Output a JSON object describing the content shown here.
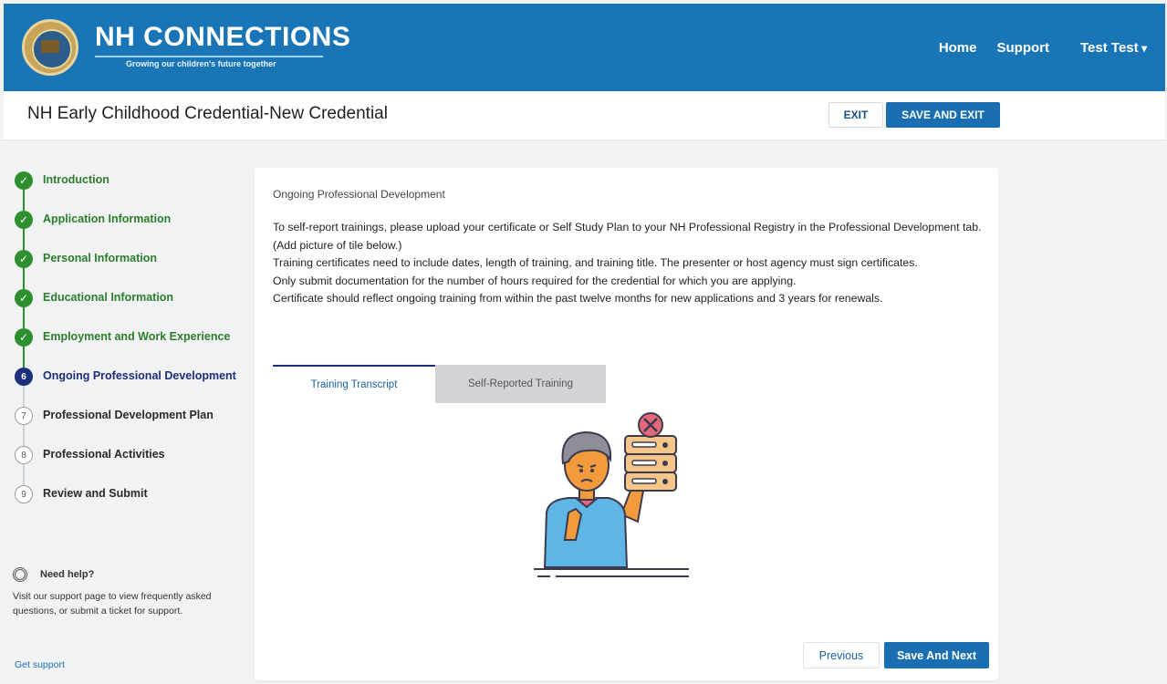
{
  "brand": {
    "title": "NH CONNECTIONS",
    "tagline": "Growing our children's future together"
  },
  "nav": {
    "home": "Home",
    "support": "Support",
    "user": "Test Test"
  },
  "header": {
    "title": "NH Early Childhood Credential-New Credential",
    "exit_label": "EXIT",
    "save_exit_label": "SAVE AND EXIT"
  },
  "steps": [
    {
      "label": "Introduction",
      "status": "done",
      "icon": "check-icon"
    },
    {
      "label": "Application Information",
      "status": "done",
      "icon": "check-icon"
    },
    {
      "label": "Personal Information",
      "status": "done",
      "icon": "check-icon"
    },
    {
      "label": "Educational Information",
      "status": "done",
      "icon": "check-icon"
    },
    {
      "label": "Employment and Work Experience",
      "status": "done",
      "icon": "check-icon"
    },
    {
      "label": "Ongoing Professional Development",
      "status": "current",
      "number": "6"
    },
    {
      "label": "Professional Development Plan",
      "status": "todo",
      "number": "7"
    },
    {
      "label": "Professional Activities",
      "status": "todo",
      "number": "8"
    },
    {
      "label": "Review and Submit",
      "status": "todo",
      "number": "9"
    }
  ],
  "help": {
    "title": "Need help?",
    "text": "Visit our support page to view frequently asked questions, or submit a ticket for support.",
    "link": "Get support"
  },
  "main": {
    "section_title": "Ongoing Professional Development",
    "instructions": [
      "To self-report trainings, please upload your certificate or Self Study Plan to your NH Professional Registry in the Professional Development tab. (Add picture of tile below.)",
      "Training certificates need to include dates, length of training, and training title. The presenter or host agency must sign certificates.",
      "Only submit documentation for the number of hours required for the credential for which you are applying.",
      "Certificate should reflect ongoing training from within the past twelve months for new applications and 3 years for renewals."
    ],
    "tabs": [
      {
        "label": "Training Transcript",
        "active": true
      },
      {
        "label": "Self-Reported Training",
        "active": false
      }
    ],
    "illustration_icon": "server-error-person-illustration",
    "previous_label": "Previous",
    "next_label": "Save And Next"
  },
  "colors": {
    "primary": "#1a75b7",
    "done": "#2e8f2e",
    "current": "#1c2f7a"
  }
}
